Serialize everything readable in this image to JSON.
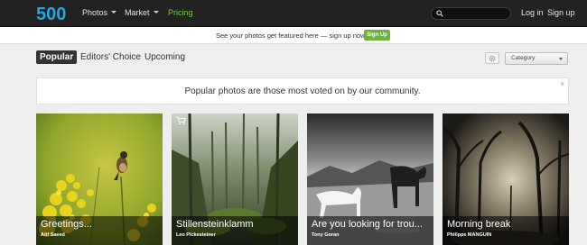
{
  "header": {
    "logo_text": "500",
    "nav": [
      {
        "label": "Photos",
        "dropdown": true
      },
      {
        "label": "Market",
        "dropdown": true
      },
      {
        "label": "Pricing",
        "dropdown": false
      }
    ],
    "search": {
      "placeholder": "",
      "value": ""
    },
    "login_label": "Log in",
    "signup_label": "Sign up"
  },
  "banner": {
    "text": "See your photos get featured here — sign up now.",
    "button_label": "Sign Up"
  },
  "tabs": [
    {
      "label": "Popular",
      "active": true
    },
    {
      "label": "Editors' Choice",
      "active": false
    },
    {
      "label": "Upcoming",
      "active": false
    }
  ],
  "filter": {
    "category_selected": "Category"
  },
  "info": {
    "text": "Popular photos are those most voted on by our community.",
    "close_label": "×"
  },
  "photos": [
    {
      "title": "Greetings...",
      "author": "Atif Saeed"
    },
    {
      "title": "Stillensteinklamm",
      "author": "Leo Pickesteiner"
    },
    {
      "title": "Are you looking for trou...",
      "author": "Tony Goran"
    },
    {
      "title": "Morning break",
      "author": "Philippe MANGUIN"
    }
  ],
  "colors": {
    "topbar": "#222222",
    "accent_green": "#6cb33e",
    "logo_blue": "#22a6e0",
    "active_tab": "#333333"
  },
  "icons": {
    "logo": "500px-logo",
    "search": "search-icon",
    "gear": "gear-icon",
    "cart": "cart-icon",
    "close": "close-icon"
  }
}
